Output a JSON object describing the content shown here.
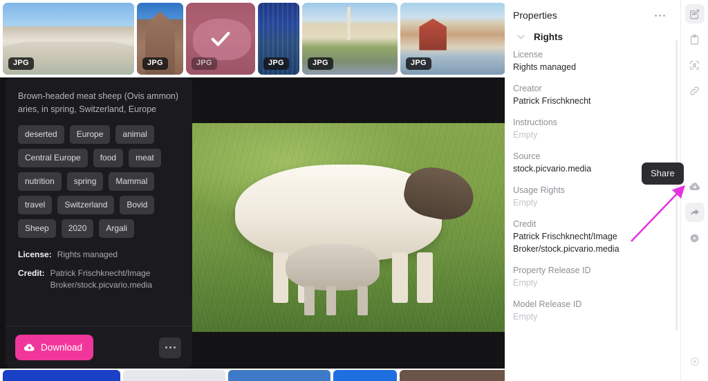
{
  "thumbnails": [
    {
      "badge": "JPG",
      "art": "art-square",
      "width": 190,
      "selected": false,
      "name": "thumbnail-square-fountain"
    },
    {
      "badge": "JPG",
      "art": "art-cath",
      "width": 67,
      "selected": false,
      "name": "thumbnail-cathedral"
    },
    {
      "badge": "JPG",
      "art": "art-sheep",
      "width": 100,
      "selected": true,
      "name": "thumbnail-sheep-selected"
    },
    {
      "badge": "JPG",
      "art": "art-city",
      "width": 60,
      "selected": false,
      "name": "thumbnail-city-night"
    },
    {
      "badge": "JPG",
      "art": "art-plaza",
      "width": 138,
      "selected": false,
      "name": "thumbnail-plaza-column"
    },
    {
      "badge": "JPG",
      "art": "art-river",
      "width": 152,
      "selected": false,
      "name": "thumbnail-riverfront"
    }
  ],
  "info": {
    "caption": "Brown-headed meat sheep (Ovis ammon) aries, in spring, Switzerland, Europe",
    "tags": [
      "deserted",
      "Europe",
      "animal",
      "Central Europe",
      "food",
      "meat",
      "nutrition",
      "spring",
      "Mammal",
      "travel",
      "Switzerland",
      "Bovid",
      "Sheep",
      "2020",
      "Argali"
    ],
    "license_label": "License:",
    "license_value": "Rights managed",
    "credit_label": "Credit:",
    "credit_value": "Patrick Frischknecht/Image Broker/stock.picvario.media",
    "download_label": "Download",
    "download_color": "#f0369b",
    "more_icon": "ellipsis-icon",
    "download_icon": "cloud-download-icon"
  },
  "properties": {
    "title": "Properties",
    "kebab_icon": "ellipsis-icon",
    "section": {
      "title": "Rights",
      "chevron_icon": "chevron-down-icon",
      "fields": [
        {
          "label": "License",
          "value": "Rights managed",
          "empty": false
        },
        {
          "label": "Creator",
          "value": "Patrick Frischknecht",
          "empty": false
        },
        {
          "label": "Instructions",
          "value": "Empty",
          "empty": true
        },
        {
          "label": "Source",
          "value": "stock.picvario.media",
          "empty": false
        },
        {
          "label": "Usage Rights",
          "value": "Empty",
          "empty": true
        },
        {
          "label": "Credit",
          "value": "Patrick Frischknecht/Image Broker/stock.picvario.media",
          "empty": false
        },
        {
          "label": "Property Release ID",
          "value": "Empty",
          "empty": true
        },
        {
          "label": "Model Release ID",
          "value": "Empty",
          "empty": true
        }
      ]
    }
  },
  "rail": {
    "top_items": [
      {
        "icon": "edit-document-icon",
        "active": true
      },
      {
        "icon": "clipboard-icon",
        "active": false
      },
      {
        "icon": "face-detect-icon",
        "active": false
      },
      {
        "icon": "link-icon",
        "active": false
      }
    ],
    "bottom_items": [
      {
        "icon": "cloud-download-icon",
        "active": false
      },
      {
        "icon": "share-arrow-icon",
        "active": true
      },
      {
        "icon": "play-circle-icon",
        "active": false
      }
    ],
    "footer_item": {
      "icon": "record-circle-icon",
      "active": false
    }
  },
  "tooltip": {
    "label": "Share",
    "arrow_color": "#e633e0"
  },
  "bottom_strip": [
    {
      "color": "#1b40c8",
      "width": 170,
      "name": "bottom-thumb-1"
    },
    {
      "color": "#e6e8ec",
      "width": 148,
      "name": "bottom-thumb-2"
    },
    {
      "color": "#3f7ac8",
      "width": 148,
      "name": "bottom-thumb-3"
    },
    {
      "color": "#1f6fe0",
      "width": 92,
      "name": "bottom-thumb-4"
    },
    {
      "color": "#6b5448",
      "width": 170,
      "name": "bottom-thumb-5"
    }
  ]
}
